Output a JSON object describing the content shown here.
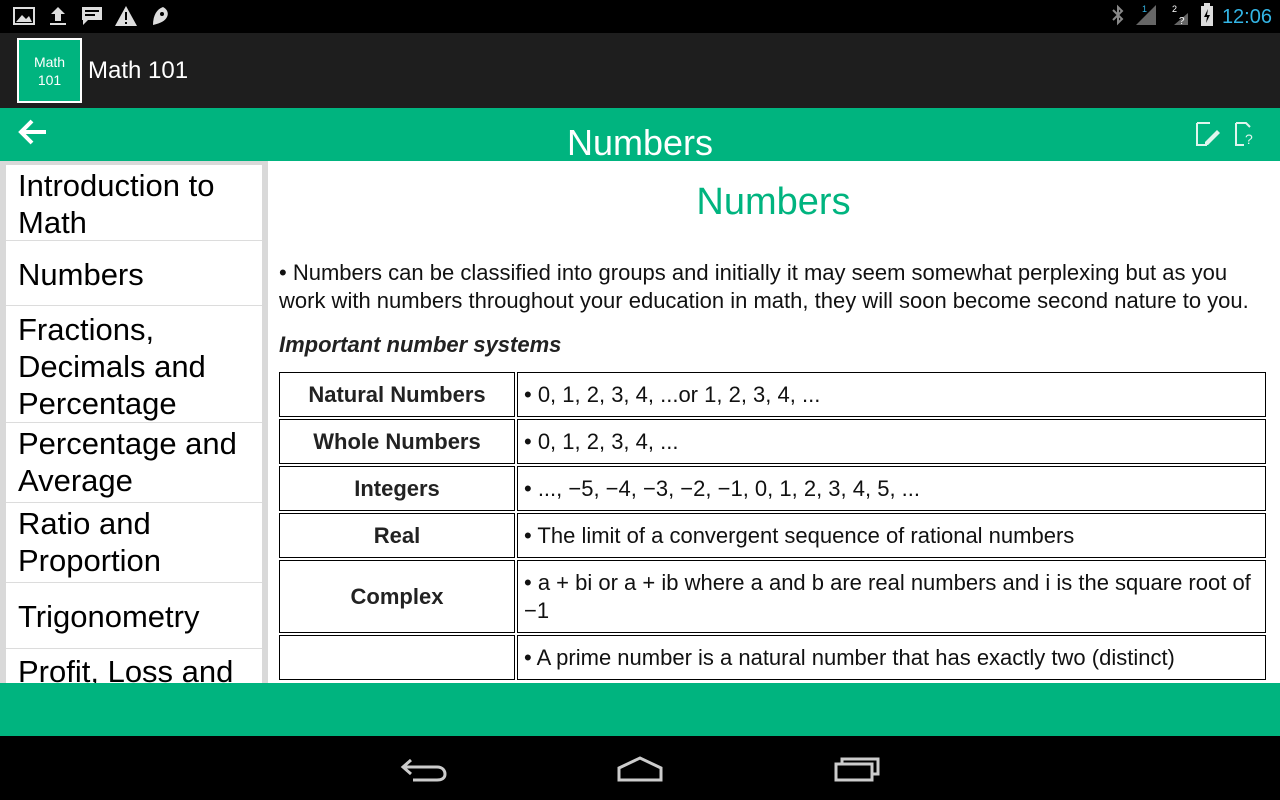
{
  "status_bar": {
    "time": "12:06",
    "left_icons": [
      "gallery-icon",
      "upload-icon",
      "chat-icon",
      "warning-icon",
      "app-notification-icon"
    ],
    "right_icons": [
      "bluetooth-icon",
      "signal-icon",
      "wifi-icon",
      "battery-icon"
    ],
    "accent": "#33b5e5"
  },
  "app": {
    "icon_line1": "Math",
    "icon_line2": "101",
    "title": "Math 101"
  },
  "toolbar": {
    "title": "Numbers",
    "color": "#00b47f"
  },
  "sidebar": {
    "items": [
      {
        "label": "Introduction to Math"
      },
      {
        "label": "Numbers"
      },
      {
        "label": "Fractions, Decimals and Percentage"
      },
      {
        "label": "Percentage and Average"
      },
      {
        "label": "Ratio and Proportion"
      },
      {
        "label": "Trigonometry"
      },
      {
        "label": "Profit, Loss and"
      }
    ]
  },
  "main": {
    "heading": "Numbers",
    "intro": "•  Numbers can be classified into groups and initially it may seem somewhat perplexing but as you work with numbers throughout your education in math, they will soon become second nature to you.",
    "subheading": "Important number systems",
    "table": [
      {
        "term": "Natural Numbers",
        "definition": "• 0, 1, 2, 3, 4, ...or 1, 2, 3, 4, ..."
      },
      {
        "term": "Whole Numbers",
        "definition": "• 0, 1, 2, 3, 4, ..."
      },
      {
        "term": "Integers",
        "definition": "• ..., −5, −4, −3, −2, −1, 0, 1, 2, 3, 4, 5, ..."
      },
      {
        "term": "Real",
        "definition": "• The limit of a convergent sequence of rational numbers"
      },
      {
        "term": "Complex",
        "definition": "• a + bi or a + ib where a and b are real numbers and i is the square root of −1"
      },
      {
        "term": "",
        "definition": "• A prime number is a natural number that has exactly two (distinct)"
      }
    ]
  }
}
